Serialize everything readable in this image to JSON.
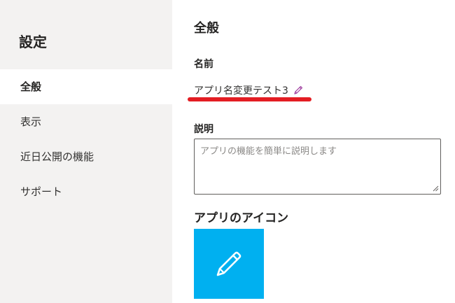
{
  "sidebar": {
    "title": "設定",
    "items": [
      {
        "label": "全般",
        "active": true
      },
      {
        "label": "表示",
        "active": false
      },
      {
        "label": "近日公開の機能",
        "active": false
      },
      {
        "label": "サポート",
        "active": false
      }
    ]
  },
  "main": {
    "section_title": "全般",
    "name_label": "名前",
    "app_name": "アプリ名変更テスト3",
    "description_label": "説明",
    "description_placeholder": "アプリの機能を簡単に説明します",
    "description_value": "",
    "icon_label": "アプリのアイコン"
  },
  "colors": {
    "sidebar_bg": "#f3f2f1",
    "accent_underline": "#e31d23",
    "icon_tile": "#00b0f0",
    "pencil_small": "#a040a0"
  },
  "icons": {
    "name_edit": "pencil-icon",
    "app_icon": "pencil-icon"
  }
}
